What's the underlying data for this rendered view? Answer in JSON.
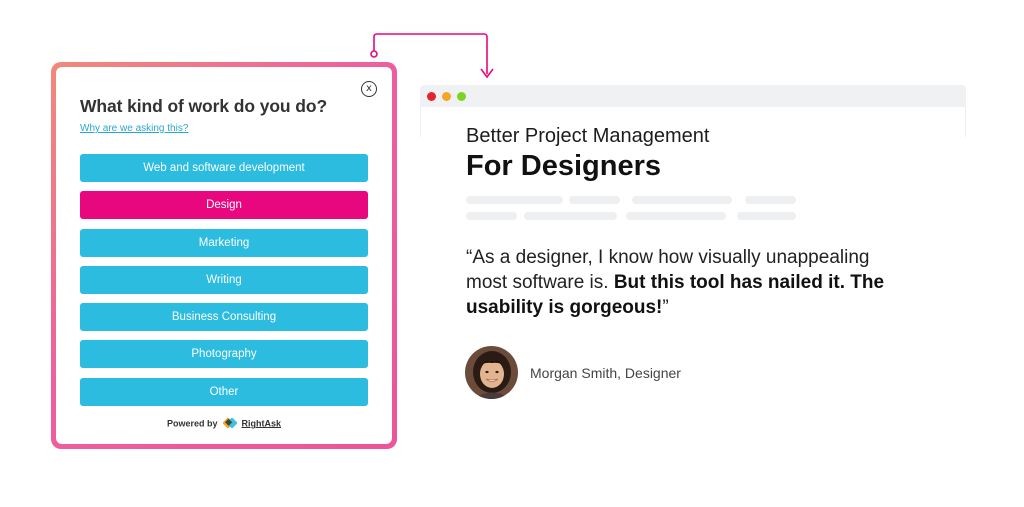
{
  "popup": {
    "close_label": "x",
    "title": "What kind of work do you do?",
    "why_link": "Why are we asking this?",
    "options": [
      {
        "label": "Web and software development",
        "selected": false
      },
      {
        "label": "Design",
        "selected": true
      },
      {
        "label": "Marketing",
        "selected": false
      },
      {
        "label": "Writing",
        "selected": false
      },
      {
        "label": "Business Consulting",
        "selected": false
      },
      {
        "label": "Photography",
        "selected": false
      },
      {
        "label": "Other",
        "selected": false
      }
    ],
    "powered_by": "Powered by",
    "brand": "RightAsk"
  },
  "page": {
    "headline_top": "Better Project Management",
    "headline_main": "For Designers",
    "quote_open": "“As a designer, I know how visually unappealing most software is. ",
    "quote_bold": "But this tool has nailed it. The usability is gorgeous!",
    "quote_close": "”",
    "author": "Morgan Smith, Designer"
  },
  "colors": {
    "accent_pink": "#e9077f",
    "option_blue": "#2bbcdf",
    "link_blue": "#2aa8cf",
    "window_red": "#e5242b",
    "window_yellow": "#f6a623",
    "window_green": "#7ed321"
  },
  "icons": {
    "close": "close-icon",
    "brand_logo": "rightask-logo-icon",
    "arrow": "connector-arrow-icon"
  }
}
